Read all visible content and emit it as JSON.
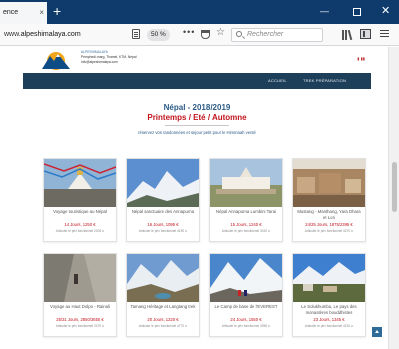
{
  "browser": {
    "tab_title": "ence",
    "tab_close": "×",
    "new_tab": "+",
    "url_prefix": "www.",
    "url_host": "alpeshimalaya.com",
    "zoom": "50 %",
    "search_placeholder": "Rechercher",
    "window_min": "—",
    "window_close": "✕",
    "overflow": "•••",
    "star": "☆"
  },
  "site": {
    "brand": "ALPESHIMALAYA",
    "contact_lines": [
      "Pemphedi-marg, Thamel, KTM, Népal",
      "info@alpeshimalaya.com"
    ],
    "flags": "▮ ▮▮",
    "nav": [
      "ACCUEIL",
      "TREK PRÉPARATION"
    ]
  },
  "hero": {
    "title": "Népal - 2018/2019",
    "subtitle": "Printemps / Eté / Automne",
    "intro": "réservez vos randonnées et sejour petit pour le Himmaah venté"
  },
  "cards": [
    {
      "name": "Voyage touristique au Népal",
      "price": "14 Jours, 1250 €",
      "avis": "Articuler le prix fonctionnel  2200 ••"
    },
    {
      "name": "Népal sanctuaire des Annapurna",
      "price": "16 Jours, 1095 €",
      "avis": "Articuler le prix fonctionnel  4190 ••"
    },
    {
      "name": "Népal Annapurna Lumbini Tarai",
      "price": "15 Jours, 1240 €",
      "avis": "Articuler le prix fonctionnel  3310 ••"
    },
    {
      "name": "Mustang - Manthang, Yara Dhara et Lori",
      "price": "24/25 Jours, 1875/2395 €",
      "avis": "Articuler le prix fonctionnel  4270 ••"
    },
    {
      "name": "Voyage au Haut Dolpo - Rainali",
      "price": "25/31 Jours, 2850/3650 €",
      "avis": "Articuler le prix fonctionnel  2470 ••"
    },
    {
      "name": "Tamang Héritage et Langtang trek",
      "price": "20 Jours, 1220 €",
      "avis": "Articuler le prix fonctionnel  4770 ••"
    },
    {
      "name": "Le Camp de base de l'EVEREST",
      "price": "24 Jours, 1550 €",
      "avis": "Articuler le prix fonctionnel  3950 ••"
    },
    {
      "name": "Le Solukhumbu, Le pays des monastères bouddhistes",
      "price": "23 Jours, 1345 €",
      "avis": "Articuler le prix fonctionnel  4210 ••"
    }
  ],
  "colors": {
    "chrome": "#0e3b6b",
    "nav": "#1e3f5a",
    "title_blue": "#2b5a86",
    "accent_red": "#c0141b"
  },
  "icons": [
    "close-icon",
    "plus-icon",
    "reader-view-icon",
    "pocket-icon",
    "star-icon",
    "search-icon",
    "library-icon",
    "sidebar-icon",
    "menu-icon",
    "scroll-top-icon"
  ]
}
